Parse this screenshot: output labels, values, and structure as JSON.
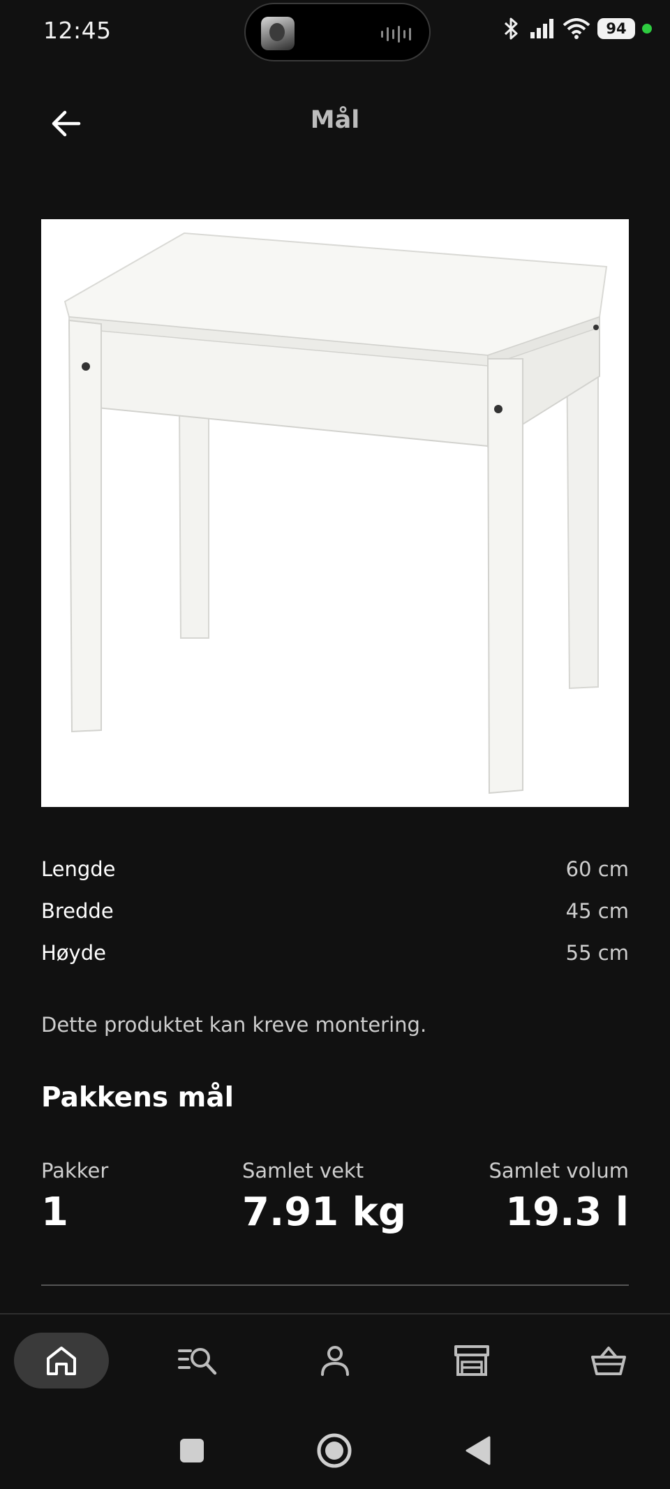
{
  "status_bar": {
    "time": "12:45",
    "battery": "94"
  },
  "header": {
    "title": "Mål"
  },
  "dimensions": [
    {
      "label": "Lengde",
      "value": "60 cm"
    },
    {
      "label": "Bredde",
      "value": "45 cm"
    },
    {
      "label": "Høyde",
      "value": "55 cm"
    }
  ],
  "assembly_note": "Dette produktet kan kreve montering.",
  "package": {
    "title": "Pakkens mål",
    "stats": [
      {
        "label": "Pakker",
        "value": "1"
      },
      {
        "label": "Samlet vekt",
        "value": "7.91 kg"
      },
      {
        "label": "Samlet volum",
        "value": "19.3 l"
      }
    ]
  },
  "bottom_nav": {
    "items": [
      {
        "icon": "home-icon",
        "active": true
      },
      {
        "icon": "search-list-icon",
        "active": false
      },
      {
        "icon": "profile-icon",
        "active": false
      },
      {
        "icon": "store-icon",
        "active": false
      },
      {
        "icon": "basket-icon",
        "active": false
      }
    ]
  },
  "colors": {
    "background": "#111111",
    "text": "#ffffff",
    "secondary_text": "#cfcfcf",
    "active_nav": "#3a3a3a"
  }
}
